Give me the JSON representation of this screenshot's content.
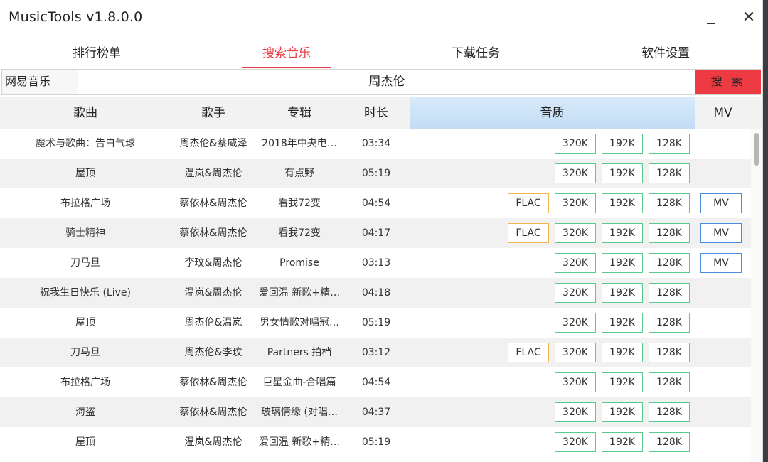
{
  "app": {
    "title": "MusicTools v1.8.0.0",
    "close_glyph": "✕"
  },
  "tabs": [
    "排行榜单",
    "搜索音乐",
    "下载任务",
    "软件设置"
  ],
  "active_tab": 1,
  "search": {
    "source": "网易音乐",
    "query": "周杰伦",
    "button": "搜 索"
  },
  "columns": {
    "song": "歌曲",
    "artist": "歌手",
    "album": "专辑",
    "duration": "时长",
    "quality": "音质",
    "mv": "MV"
  },
  "rows": [
    {
      "song": "魔术与歌曲：告白气球",
      "artist": "周杰伦&蔡威泽",
      "album": "2018年中央电…",
      "duration": "03:34",
      "flac": false,
      "mv": false
    },
    {
      "song": "屋顶",
      "artist": "温岚&周杰伦",
      "album": "有点野",
      "duration": "05:19",
      "flac": false,
      "mv": false
    },
    {
      "song": "布拉格广场",
      "artist": "蔡依林&周杰伦",
      "album": "看我72变",
      "duration": "04:54",
      "flac": true,
      "mv": true
    },
    {
      "song": "骑士精神",
      "artist": "蔡依林&周杰伦",
      "album": "看我72变",
      "duration": "04:17",
      "flac": true,
      "mv": true
    },
    {
      "song": "刀马旦",
      "artist": "李玟&周杰伦",
      "album": "Promise",
      "duration": "03:13",
      "flac": false,
      "mv": true
    },
    {
      "song": "祝我生日快乐 (Live)",
      "artist": "温岚&周杰伦",
      "album": "爱回温 新歌+精…",
      "duration": "04:18",
      "flac": false,
      "mv": false
    },
    {
      "song": "屋顶",
      "artist": "周杰伦&温岚",
      "album": "男女情歌对唱冠…",
      "duration": "05:19",
      "flac": false,
      "mv": false
    },
    {
      "song": "刀马旦",
      "artist": "周杰伦&李玟",
      "album": "Partners 拍档",
      "duration": "03:12",
      "flac": true,
      "mv": false
    },
    {
      "song": "布拉格广场",
      "artist": "蔡依林&周杰伦",
      "album": "巨星金曲-合唱篇",
      "duration": "04:54",
      "flac": false,
      "mv": false
    },
    {
      "song": "海盗",
      "artist": "蔡依林&周杰伦",
      "album": "玻璃情缘 (对唱…",
      "duration": "04:37",
      "flac": false,
      "mv": false
    },
    {
      "song": "屋顶",
      "artist": "温岚&周杰伦",
      "album": "爱回温 新歌+精…",
      "duration": "05:19",
      "flac": false,
      "mv": false
    }
  ],
  "buttons": {
    "flac": "FLAC",
    "q320": "320K",
    "q192": "192K",
    "q128": "128K",
    "mv": "MV"
  },
  "colors": {
    "accent": "#e83b45",
    "search_button": "#ee3a43",
    "quality_border": "#59c98c",
    "flac_border": "#f0b64c",
    "mv_border": "#4a8fde",
    "header_quality_bg": "#c3ddf5"
  }
}
